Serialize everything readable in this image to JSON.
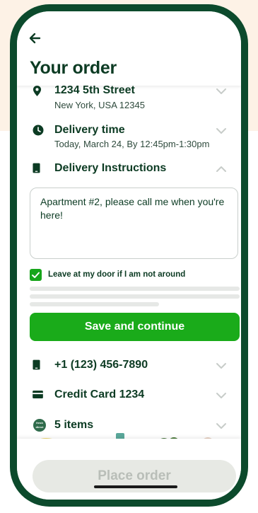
{
  "header": {
    "title": "Your order"
  },
  "address": {
    "line1": "1234 5th Street",
    "line2": "New York, USA 12345"
  },
  "delivery_time": {
    "label": "Delivery time",
    "value": "Today, March 24, By 12:45pm-1:30pm"
  },
  "instructions": {
    "label": "Delivery Instructions",
    "text": "Apartment #2, please call me when you're here!",
    "leave_at_door": "Leave at my door if I am not around",
    "leave_at_door_checked": true
  },
  "save_button": "Save and continue",
  "phone": {
    "value": "+1 (123) 456-7890"
  },
  "payment": {
    "value": "Credit Card 1234"
  },
  "items": {
    "label": "5 items",
    "badge_line1": "fresh",
    "badge_line2": "direct"
  },
  "footer": {
    "place_order": "Place order"
  },
  "colors": {
    "brand_dark": "#0c4a2c",
    "accent_green": "#1aab1a",
    "text_dark": "#0c3b23",
    "peach_background": "#fdf2e6",
    "disabled_button": "#e7e9e4",
    "disabled_text": "#b9beb8"
  },
  "icons": {
    "back": "arrow-left-icon",
    "address": "location-pin-icon",
    "time": "clock-icon",
    "instructions": "mobile-device-icon",
    "phone": "mobile-device-icon",
    "payment": "credit-card-icon",
    "items": "fresh-direct-logo-icon",
    "expand": "chevron-down-icon",
    "collapse": "chevron-up-icon",
    "checkbox": "checkmark-icon"
  }
}
